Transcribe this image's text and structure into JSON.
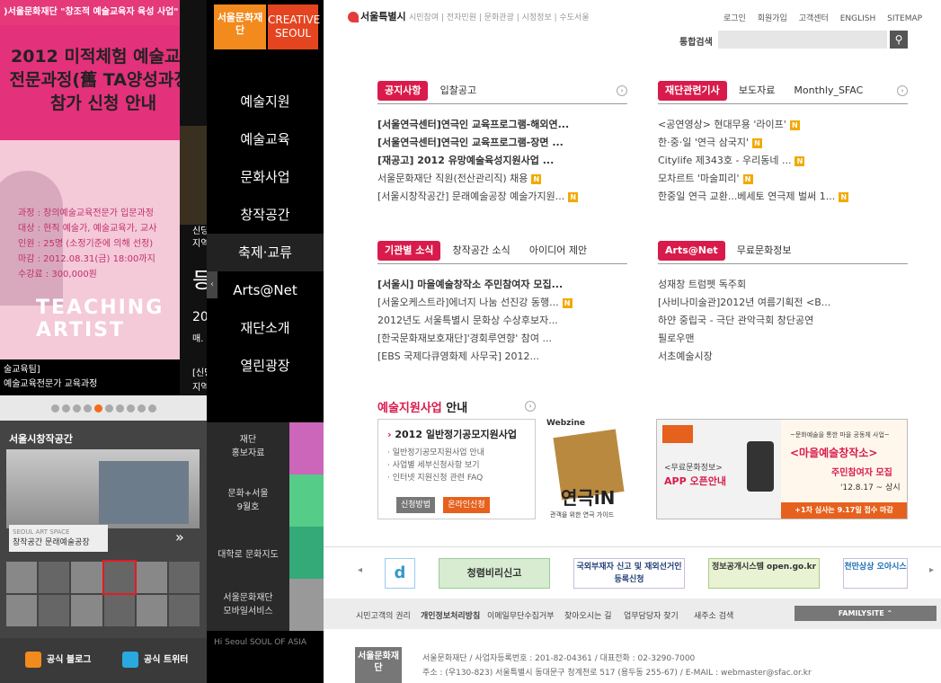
{
  "promo": {
    "top_bar": ")서울문화재단 \"창조적 예술교육자 육성 사업\"",
    "title_lines": [
      "2012 미적체험 예술교육",
      "전문과정(舊 TA양성과정)",
      "참가 신청 안내"
    ],
    "details": [
      "과정 : 창의예술교육전문가 입문과정",
      "대상 : 현직 예술가, 예술교육가, 교사",
      "인원 : 25명 (소정기준에 의해 선정)",
      "마감 : 2012.08.31(금) 18:00까지",
      "수강료 : 300,000원"
    ],
    "logo_text": "TEACHING ARTIST",
    "caption_lines": [
      "술교육팀]",
      "예술교육전문가 교육과정"
    ]
  },
  "promo2": {
    "lines": [
      "신당",
      "지역",
      "등",
      "20",
      "매.",
      "[신당",
      "지역"
    ]
  },
  "nav": {
    "logo_sfac": "서울문화재단",
    "logo_creative": "CREATIVE SEOUL",
    "items": [
      "예술지원",
      "예술교육",
      "문화사업",
      "창작공간",
      "축제·교류",
      "Arts@Net",
      "재단소개",
      "열린광장"
    ]
  },
  "space": {
    "title": "서울시창작공간",
    "sign": "창작공간 문래예술공장",
    "sign_en": "SEOUL ART SPACE"
  },
  "midbar": {
    "items": [
      "재단\n홍보자료",
      "문화+서울\n9월호",
      "대학로 문화지도",
      "서울문화재단\n모바일서비스"
    ],
    "footer": "Hi Seoul SOUL OF ASIA"
  },
  "social": {
    "blog": "공식 블로그",
    "twitter": "공식 트위터"
  },
  "header": {
    "seoul": "서울특별시",
    "topnav": "시민참여 | 전자민원 | 문화관광 | 시정정보 | 수도서울",
    "util": [
      "로그인",
      "회원가입",
      "고객센터",
      "ENGLISH",
      "SITEMAP"
    ],
    "search_label": "통합검색",
    "search_placeholder": ""
  },
  "board_notice": {
    "tabs": [
      "공지사항",
      "입찰공고"
    ],
    "items": [
      {
        "text": "[서울연극센터]연극인 교육프로그램-해외연...",
        "bold": true,
        "new": false
      },
      {
        "text": "[서울연극센터]연극인 교육프로그램-장면 ...",
        "bold": true,
        "new": false
      },
      {
        "text": "[재공고] 2012 유망예술육성지원사업 ...",
        "bold": true,
        "new": false
      },
      {
        "text": "서울문화재단 직원(전산관리직) 채용",
        "bold": false,
        "new": true
      },
      {
        "text": "[서울시창작공간] 문래예술공장 예술가지원...",
        "bold": false,
        "new": true
      }
    ]
  },
  "board_news": {
    "tabs": [
      "재단관련기사",
      "보도자료",
      "Monthly_SFAC"
    ],
    "items": [
      {
        "text": "<공연영상> 현대무용 '라이프'",
        "new": true
      },
      {
        "text": "한·중·일 '연극 삼국지'",
        "new": true
      },
      {
        "text": "Citylife 제343호 - 우리동네 ...",
        "new": true
      },
      {
        "text": "모차르트 '마술피리'",
        "new": true
      },
      {
        "text": "한중일 연극 교환...베세토 연극제 벌써 1...",
        "new": true
      }
    ]
  },
  "board_org": {
    "tabs": [
      "기관별 소식",
      "창작공간 소식",
      "아이디어 제안"
    ],
    "items": [
      {
        "text": "[서울시] 마을예술창작소 주민참여자 모집...",
        "bold": true,
        "new": false
      },
      {
        "text": "[서울오케스트라]에너지 나눔 선진강 동행...",
        "bold": false,
        "new": true
      },
      {
        "text": "2012년도 서울특별시 문화상 수상후보자...",
        "bold": false,
        "new": false
      },
      {
        "text": "[한국문화재보호재단]'경회루연향' 참여 ...",
        "bold": false,
        "new": false
      },
      {
        "text": "[EBS 국제다큐영화제 사무국] 2012...",
        "bold": false,
        "new": false
      }
    ]
  },
  "board_arts": {
    "tabs": [
      "Arts@Net",
      "무료문화정보"
    ],
    "items": [
      {
        "text": "성재창 트럼펫 독주회"
      },
      {
        "text": "[사비나미술관]2012년 여름기획전 <B..."
      },
      {
        "text": "하얀 중립국 - 극단 관악극회 창단공연"
      },
      {
        "text": "필로우맨"
      },
      {
        "text": "서초예술시장"
      }
    ]
  },
  "new_badge": "N",
  "support": {
    "title_red": "예술지원사업",
    "title_rest": " 안내",
    "heading": "2012 일반정기공모지원사업",
    "lines": [
      "· 일반정기공모지원사업 안내",
      "· 사업별 세부신청사항 보기",
      "· 인터넷 지원신청 관련 FAQ"
    ],
    "btn_how": "신청방법",
    "btn_online": "온라인신청"
  },
  "webzine": {
    "label": "Webzine",
    "name": "연극iN",
    "sub": "관객을 위한 연극 가이드"
  },
  "banner": {
    "app_small": "<무료문화정보>",
    "app_big": "APP 오픈안내",
    "right_small": "~문화예술을 통한 마을 공동체 사업~",
    "right_big": "<마을예술창작소>",
    "right_sub": "주민참여자 모집",
    "right_date": "'12.8.17 ~ 상시",
    "right_foot": "+1차 심사는 9.17일 접수 마감"
  },
  "partners": [
    "d",
    "청렴비리신고",
    "국외부재자 신고 및 재외선거인 등록신청",
    "정보공개시스템 open.go.kr",
    "천만상상 오아시스"
  ],
  "footer_links": [
    "시민고객의 권리",
    "개인정보처리방침",
    "이메일무단수집거부",
    "찾아오시는 길",
    "업무담당자 찾기",
    "새주소 검색"
  ],
  "familysite": "FAMILYSITE",
  "footer": {
    "logo": "서울문화재단",
    "line1": "서울문화재단 / 사업자등록번호 : 201-82-04361 / 대표전화 : 02-3290-7000",
    "line2": "주소 : (우130-823) 서울특별시 동대문구 청계천로 517 (용두동 255-67) / E-MAIL : webmaster@sfac.or.kr"
  },
  "colors": {
    "accent": "#d91b4b",
    "orange": "#f28a1d",
    "new": "#f2a900"
  }
}
